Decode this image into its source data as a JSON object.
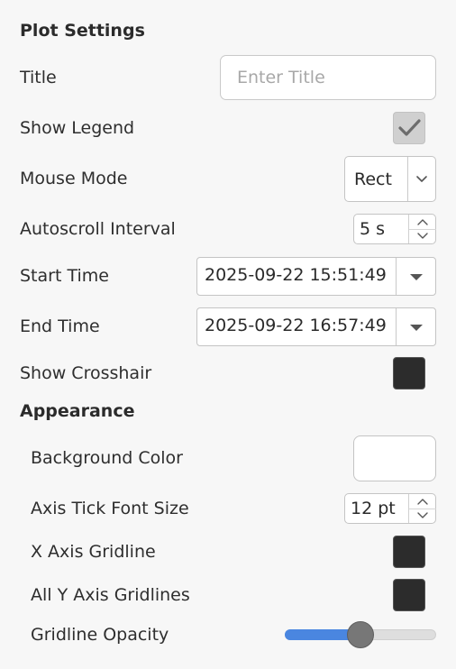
{
  "plot_settings": {
    "heading": "Plot Settings",
    "title_label": "Title",
    "title_placeholder": "Enter Title",
    "title_value": "",
    "show_legend_label": "Show Legend",
    "show_legend_checked": true,
    "mouse_mode_label": "Mouse Mode",
    "mouse_mode_value": "Rect",
    "autoscroll_label": "Autoscroll Interval",
    "autoscroll_value": "5 s",
    "start_time_label": "Start Time",
    "start_time_value": "2025-09-22 15:51:49",
    "end_time_label": "End Time",
    "end_time_value": "2025-09-22 16:57:49",
    "show_crosshair_label": "Show Crosshair",
    "show_crosshair_checked": false
  },
  "appearance": {
    "heading": "Appearance",
    "background_color_label": "Background Color",
    "background_color_value": "#ffffff",
    "axis_tick_font_size_label": "Axis Tick Font Size",
    "axis_tick_font_size_value": "12 pt",
    "x_axis_gridline_label": "X Axis Gridline",
    "x_axis_gridline_checked": false,
    "all_y_axis_gridlines_label": "All Y Axis Gridlines",
    "all_y_axis_gridlines_checked": false,
    "gridline_opacity_label": "Gridline Opacity",
    "gridline_opacity_fraction": 0.5
  },
  "colors": {
    "slider_fill": "#4a86e0",
    "checkbox_unchecked": "#2c2c2c",
    "checkbox_checked": "#d0d0d0"
  },
  "icons": [
    "checkmark-icon",
    "chevron-down-icon",
    "spin-up-icon",
    "spin-down-icon",
    "dropdown-arrow-icon"
  ]
}
